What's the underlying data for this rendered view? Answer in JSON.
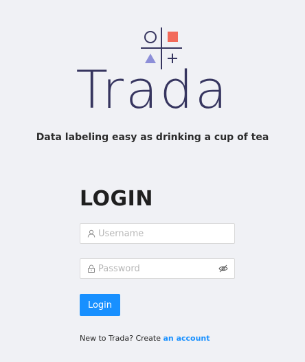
{
  "brand": {
    "name": "Trada",
    "tagline": "Data labeling easy as drinking a cup of tea",
    "logo_icon": "trada-logo-icon",
    "colors": {
      "circle": "#36355f",
      "square": "#f26a5a",
      "triangle": "#8d8fd8",
      "lines": "#36355f"
    }
  },
  "login": {
    "title": "LOGIN",
    "username": {
      "placeholder": "Username",
      "value": "",
      "icon": "user-icon"
    },
    "password": {
      "placeholder": "Password",
      "value": "",
      "icon": "lock-icon",
      "toggle_icon": "eye-invisible-icon"
    },
    "submit_label": "Login",
    "submit_color": "#1890ff"
  },
  "signup": {
    "prompt": "New to Trada? Create ",
    "link_label": "an account"
  }
}
